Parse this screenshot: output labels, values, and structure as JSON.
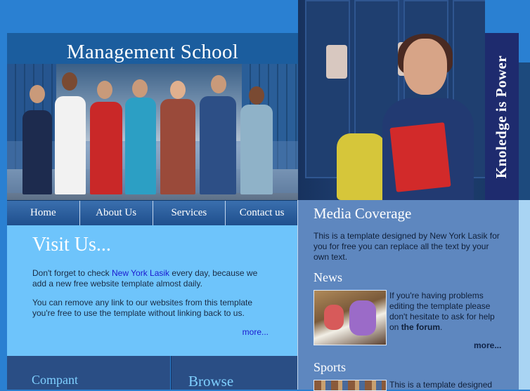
{
  "header": {
    "title": "Management School",
    "slogan": "Knoledge is Power"
  },
  "nav": {
    "items": [
      "Home",
      "About Us",
      "Services",
      "Contact us"
    ]
  },
  "visit": {
    "heading": "Visit Us...",
    "p1_before": "Don't forget to check ",
    "p1_link": "New York Lasik",
    "p1_after": " every day, because we add a new free website template almost daily.",
    "p2": "You can remove any link to our websites from this template you're free to use the template without linking back to us.",
    "more": "more..."
  },
  "bottom": {
    "left_heading": "Compant",
    "mid_heading": "Browse"
  },
  "media": {
    "heading": "Media Coverage",
    "text": "This is a template designed by New York Lasik for you for free you can replace all the text by your own text."
  },
  "news": {
    "heading": "News",
    "text_before": "If you're having problems editing the template please don't hesitate to ask for help on ",
    "text_link": "the forum",
    "text_after": ".",
    "more": "more..."
  },
  "sports": {
    "heading": "Sports",
    "text": "This is a template designed"
  },
  "colors": {
    "brand_blue": "#2a80d2",
    "visit_bg": "#6ec4fb",
    "right_col_bg": "#5e87bf",
    "slogan_bg": "#1e2b6e"
  }
}
